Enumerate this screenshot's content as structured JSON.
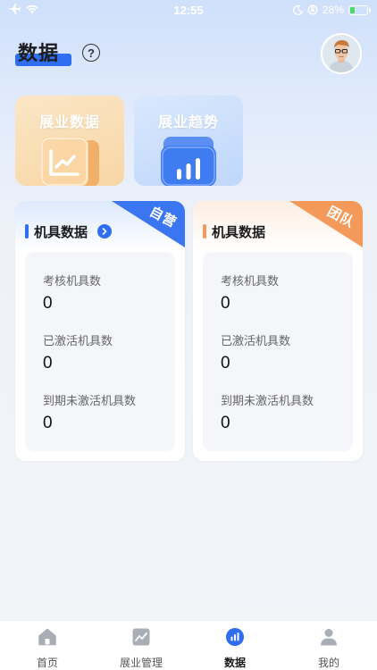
{
  "status_bar": {
    "time": "12:55",
    "battery_percent": "28%",
    "battery_level": 0.28
  },
  "header": {
    "title": "数据"
  },
  "function_cards": [
    {
      "label": "展业数据"
    },
    {
      "label": "展业趋势"
    }
  ],
  "panels": {
    "self": {
      "title": "机具数据",
      "badge": "自营",
      "stats": [
        {
          "label": "考核机具数",
          "value": "0"
        },
        {
          "label": "已激活机具数",
          "value": "0"
        },
        {
          "label": "到期未激活机具数",
          "value": "0"
        }
      ]
    },
    "team": {
      "title": "机具数据",
      "badge": "团队",
      "stats": [
        {
          "label": "考核机具数",
          "value": "0"
        },
        {
          "label": "已激活机具数",
          "value": "0"
        },
        {
          "label": "到期未激活机具数",
          "value": "0"
        }
      ]
    }
  },
  "tabbar": [
    {
      "label": "首页",
      "icon": "home-icon"
    },
    {
      "label": "展业管理",
      "icon": "trend-chart-icon"
    },
    {
      "label": "数据",
      "icon": "bar-chart-icon",
      "active": true
    },
    {
      "label": "我的",
      "icon": "user-icon"
    }
  ],
  "colors": {
    "accent": "#2f6ef0",
    "team_accent": "#f39a5b",
    "self_badge": "#3a75f2"
  }
}
